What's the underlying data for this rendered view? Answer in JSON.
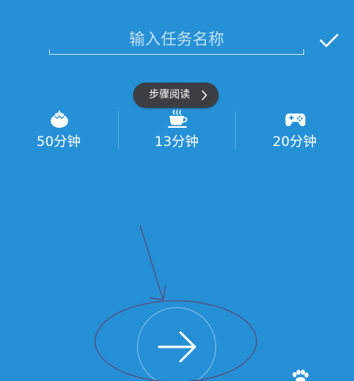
{
  "task_input": {
    "placeholder": "输入任务名称",
    "value": ""
  },
  "confirm": {
    "icon": "checkmark-icon"
  },
  "tooltip": {
    "text": "步骤阅读",
    "icon": "chevron-right-icon"
  },
  "durations": [
    {
      "icon": "tomato-icon",
      "label": "50分钟"
    },
    {
      "icon": "coffee-cup-icon",
      "label": "13分钟"
    },
    {
      "icon": "gamepad-icon",
      "label": "20分钟"
    }
  ],
  "start_button": {
    "icon": "arrow-right-icon"
  },
  "corner_icon": "paw-icon",
  "colors": {
    "background": "#2590d6",
    "tooltip_background": "#3b3f44",
    "annotation_stroke": "#5a4a7a"
  }
}
